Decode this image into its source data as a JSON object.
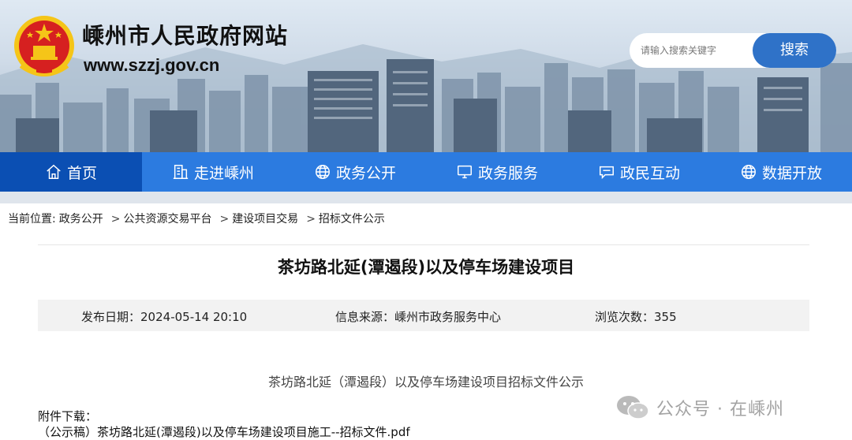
{
  "site": {
    "title": "嵊州市人民政府网站",
    "url": "www.szzj.gov.cn"
  },
  "search": {
    "placeholder": "请输入搜索关键字",
    "button_label": "搜索"
  },
  "nav": {
    "items": [
      {
        "label": "首页",
        "icon": "home-icon",
        "active": true
      },
      {
        "label": "走进嵊州",
        "icon": "building-icon",
        "active": false
      },
      {
        "label": "政务公开",
        "icon": "globe-icon",
        "active": false
      },
      {
        "label": "政务服务",
        "icon": "monitor-icon",
        "active": false
      },
      {
        "label": "政民互动",
        "icon": "chat-icon",
        "active": false
      },
      {
        "label": "数据开放",
        "icon": "globe-icon",
        "active": false
      }
    ]
  },
  "breadcrumb": {
    "prefix": "当前位置:",
    "items": [
      "政务公开",
      "公共资源交易平台",
      "建设项目交易",
      "招标文件公示"
    ],
    "separator": ">"
  },
  "article": {
    "title": "茶坊路北延(潭遏段)以及停车场建设项目",
    "meta": {
      "date_label": "发布日期：",
      "date": "2024-05-14 20:10",
      "source_label": "信息来源：",
      "source": "嵊州市政务服务中心",
      "views_label": "浏览次数：",
      "views": "355"
    },
    "body": "茶坊路北延（潭遏段）以及停车场建设项目招标文件公示",
    "attachment_label": "附件下载：",
    "attachment": "（公示稿）茶坊路北延(潭遏段)以及停车场建设项目施工--招标文件.pdf"
  },
  "watermark": {
    "text": "公众号 · 在嵊州"
  },
  "colors": {
    "nav_bg": "#2c7be0",
    "nav_active": "#0b4fb3",
    "search_button": "#2f72c8",
    "emblem_red": "#d62020",
    "emblem_gold": "#f5c518"
  }
}
